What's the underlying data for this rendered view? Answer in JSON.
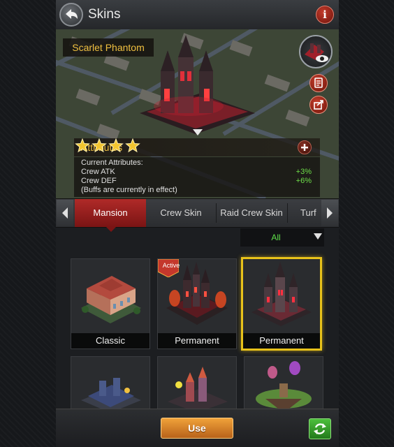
{
  "header": {
    "title": "Skins",
    "back_icon": "back-arrow-icon",
    "info_icon": "info-icon",
    "info_glyph": "i"
  },
  "preview": {
    "skin_name": "Scarlet Phantom",
    "preview_icon": "eye-icon",
    "side_buttons": [
      "document-icon",
      "share-icon"
    ],
    "collapse_icon": "chevron-down-icon"
  },
  "attributes": {
    "title": "Attributes",
    "stars": 4,
    "current_label": "Current Attributes:",
    "items": [
      {
        "name": "Crew ATK",
        "value": "+3%"
      },
      {
        "name": "Crew DEF",
        "value": "+6%"
      }
    ],
    "note": "(Buffs are currently in effect)"
  },
  "tabs": {
    "items": [
      {
        "label": "Mansion",
        "active": true
      },
      {
        "label": "Crew Skin",
        "active": false
      },
      {
        "label": "Raid Crew Skin",
        "active": false
      },
      {
        "label": "Turf",
        "active": false
      }
    ]
  },
  "filter": {
    "selected": "All"
  },
  "skins": [
    {
      "label": "Classic",
      "active": false,
      "selected": false
    },
    {
      "label": "Permanent",
      "active": true,
      "badge": "Active",
      "selected": false
    },
    {
      "label": "Permanent",
      "active": false,
      "selected": true
    },
    {
      "label": "",
      "active": false,
      "selected": false
    },
    {
      "label": "",
      "active": false,
      "selected": false
    },
    {
      "label": "",
      "active": false,
      "selected": false
    }
  ],
  "footer": {
    "use_label": "Use",
    "refresh_icon": "refresh-icon"
  },
  "colors": {
    "accent_gold": "#f0c040",
    "buff_green": "#6fe04a",
    "tab_active": "#b02a28",
    "selected_border": "#e8c21a"
  }
}
